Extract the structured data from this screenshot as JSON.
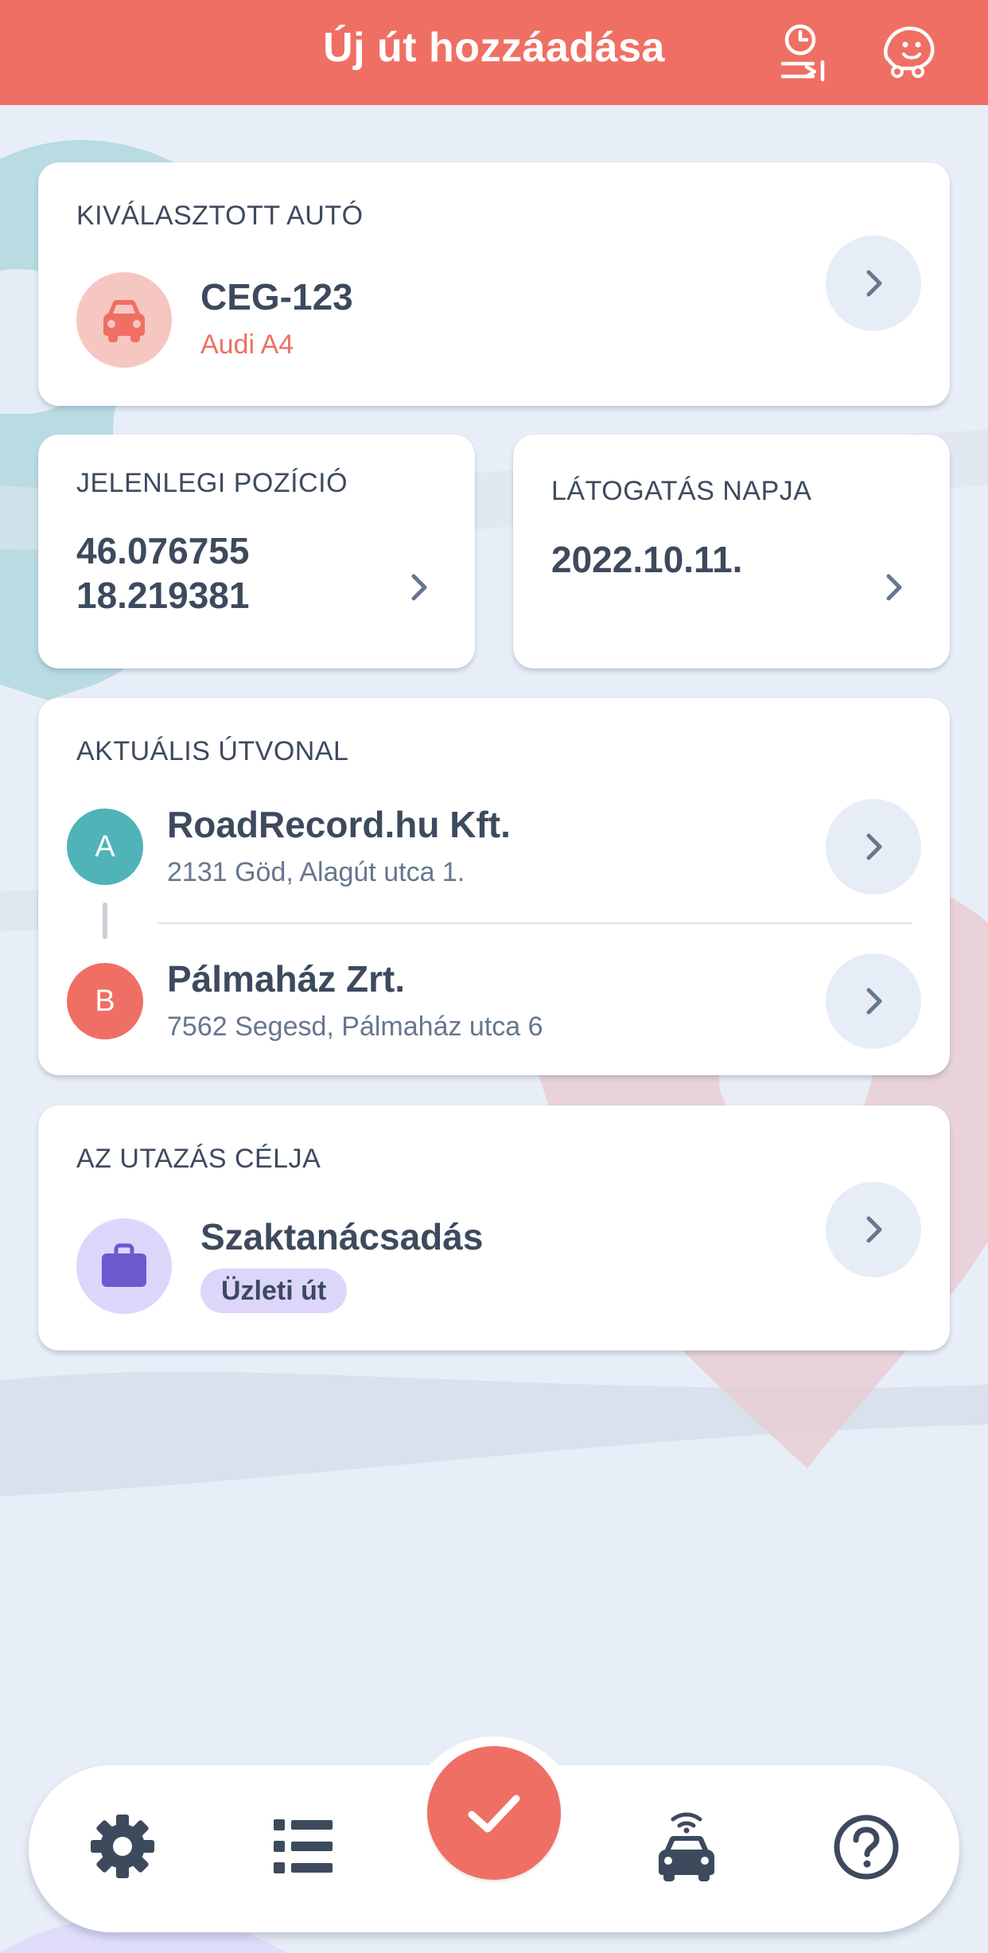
{
  "header": {
    "title": "Új út hozzáadása",
    "bg_color": "#ef6f64",
    "icons": [
      "history-forward-icon",
      "waze-icon"
    ]
  },
  "car_card": {
    "label": "KIVÁLASZTOTT AUTÓ",
    "plate": "CEG-123",
    "model": "Audi A4",
    "icon": "car-icon"
  },
  "position_card": {
    "label": "JELENLEGI POZÍCIÓ",
    "lat": "46.076755",
    "lon": "18.219381"
  },
  "date_card": {
    "label": "LÁTOGATÁS NAPJA",
    "date": "2022.10.11."
  },
  "route_card": {
    "label": "AKTUÁLIS ÚTVONAL",
    "stops": [
      {
        "letter": "A",
        "name": "RoadRecord.hu Kft.",
        "address": "2131 Göd, Alagút utca 1.",
        "color": "#4fb3b7"
      },
      {
        "letter": "B",
        "name": "Pálmaház Zrt.",
        "address": "7562 Segesd, Pálmaház utca 6",
        "color": "#ef6f64"
      }
    ]
  },
  "purpose_card": {
    "label": "AZ UTAZÁS CÉLJA",
    "title": "Szaktanácsadás",
    "badge": "Üzleti út",
    "icon": "briefcase-icon"
  },
  "bottom_nav": {
    "items": [
      "settings-icon",
      "list-icon",
      "confirm-check-icon",
      "connected-car-icon",
      "help-icon"
    ],
    "accent": "#ef6f64"
  }
}
